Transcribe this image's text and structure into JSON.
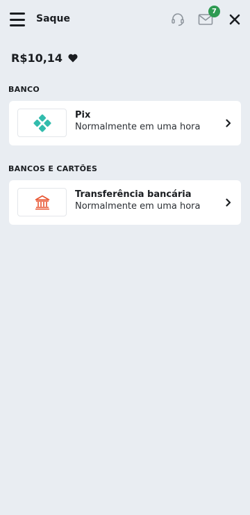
{
  "header": {
    "title": "Saque",
    "menu_icon": "hamburger-icon",
    "support_icon": "headset-icon",
    "mail_icon": "envelope-icon",
    "mail_badge": "7",
    "close_icon": "close-icon"
  },
  "balance": {
    "amount": "R$10,14",
    "icon": "heart-icon"
  },
  "sections": [
    {
      "label": "BANCO",
      "methods": [
        {
          "name": "Pix",
          "subtitle": "Normalmente em uma hora",
          "icon": "pix-icon",
          "color": "#32bcad"
        }
      ]
    },
    {
      "label": "BANCOS E CARTÕES",
      "methods": [
        {
          "name": "Transferência bancária",
          "subtitle": "Normalmente em uma hora",
          "icon": "bank-icon",
          "color": "#e8522e"
        }
      ]
    }
  ],
  "colors": {
    "background": "#e9edf2",
    "badge": "#2e9a52",
    "text": "#1a1d21"
  }
}
